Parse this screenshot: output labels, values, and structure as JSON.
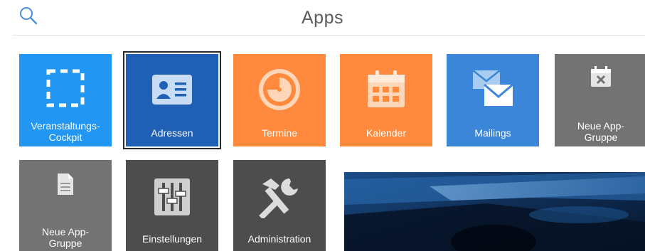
{
  "header": {
    "title": "Apps",
    "search_icon": "search-icon"
  },
  "tiles": [
    {
      "label": "Veranstaltungs-\nCockpit",
      "icon": "dashed-square-icon",
      "color": "#2196f3"
    },
    {
      "label": "Adressen",
      "icon": "contact-card-icon",
      "color": "#1f5fb5",
      "selected": true
    },
    {
      "label": "Termine",
      "icon": "clock-dial-icon",
      "color": "#ff8a3d"
    },
    {
      "label": "Kalender",
      "icon": "calendar-icon",
      "color": "#ff8a3d"
    },
    {
      "label": "Mailings",
      "icon": "envelopes-icon",
      "color": "#3b86d9"
    },
    {
      "label": "Neue App-\nGruppe",
      "icon": "calendar-delete-icon",
      "color": "#737373"
    },
    {
      "label": "Neue App-\nGruppe",
      "icon": "document-icon",
      "color": "#737373"
    },
    {
      "label": "Einstellungen",
      "icon": "sliders-icon",
      "color": "#4d4d4d"
    },
    {
      "label": "Administration",
      "icon": "tools-icon",
      "color": "#4d4d4d"
    }
  ],
  "banner": {
    "image": "blue-photo-banner"
  }
}
